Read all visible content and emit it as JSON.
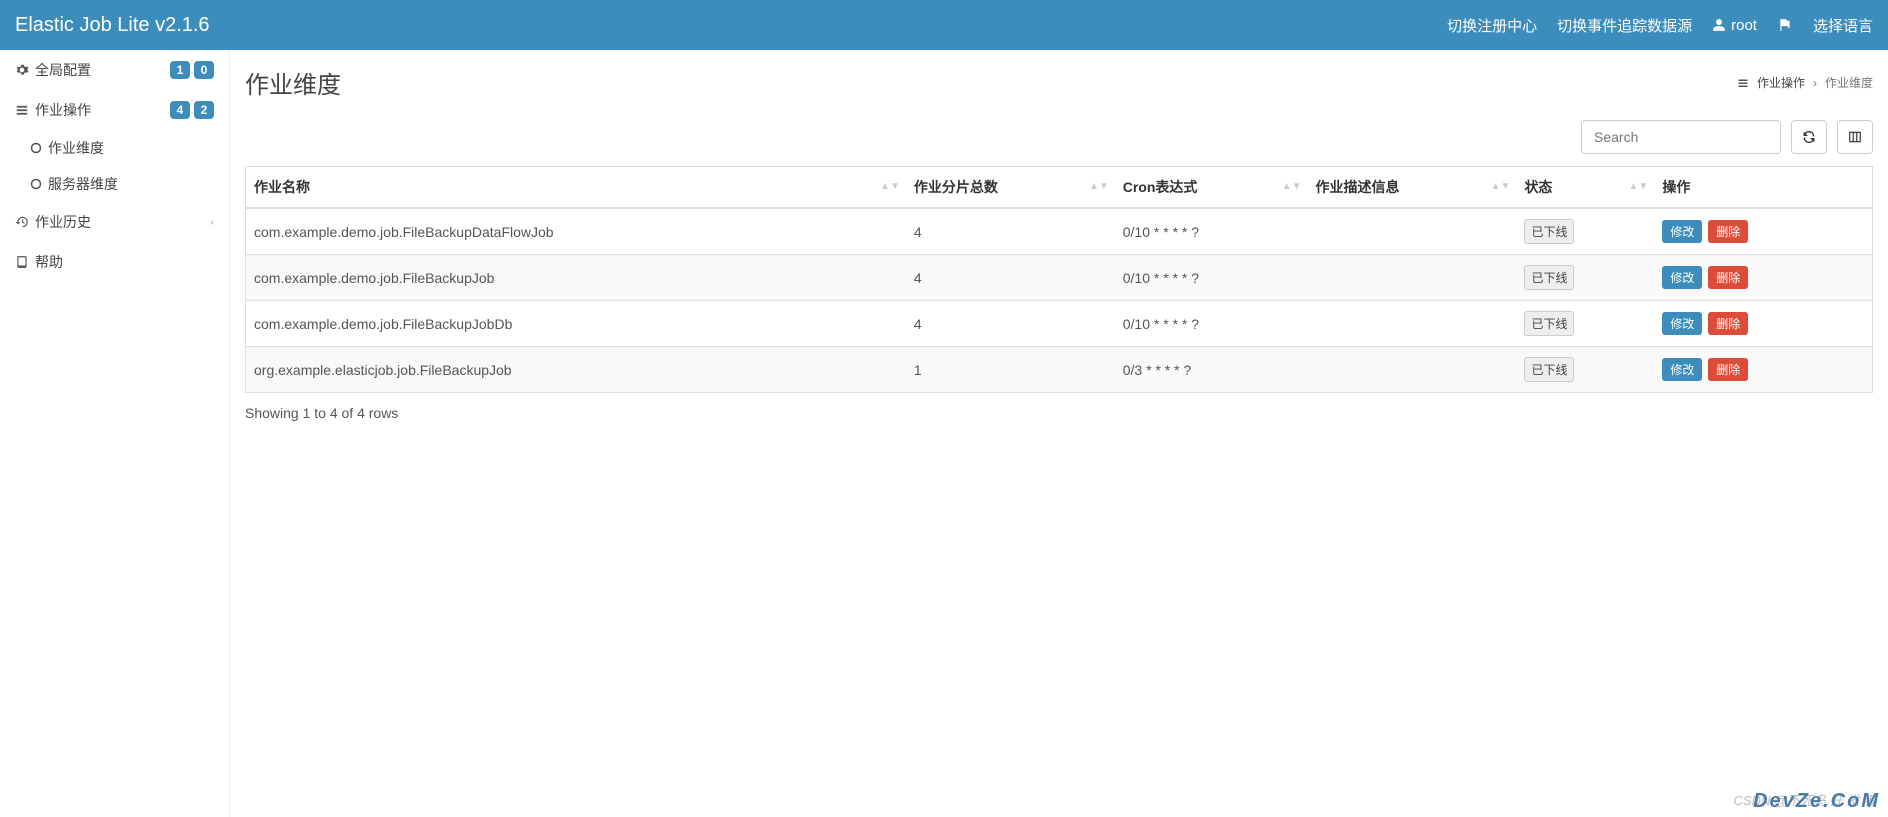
{
  "header": {
    "brand": "Elastic Job Lite v2.1.6",
    "nav": {
      "switchRegistry": "切换注册中心",
      "switchDataSource": "切换事件追踪数据源",
      "user": "root",
      "language": "选择语言"
    }
  },
  "sidebar": {
    "globalConfig": {
      "label": "全局配置",
      "badge1": "1",
      "badge2": "0"
    },
    "jobOps": {
      "label": "作业操作",
      "badge1": "4",
      "badge2": "2"
    },
    "jobDimension": {
      "label": "作业维度"
    },
    "serverDimension": {
      "label": "服务器维度"
    },
    "jobHistory": {
      "label": "作业历史"
    },
    "help": {
      "label": "帮助"
    }
  },
  "page": {
    "title": "作业维度",
    "breadcrumb": {
      "parent": "作业操作",
      "current": "作业维度"
    }
  },
  "toolbar": {
    "searchPlaceholder": "Search"
  },
  "table": {
    "headers": {
      "name": "作业名称",
      "shardCount": "作业分片总数",
      "cron": "Cron表达式",
      "desc": "作业描述信息",
      "status": "状态",
      "ops": "操作"
    },
    "rows": [
      {
        "name": "com.example.demo.job.FileBackupDataFlowJob",
        "shardCount": "4",
        "cron": "0/10 * * * * ?",
        "desc": "",
        "status": "已下线"
      },
      {
        "name": "com.example.demo.job.FileBackupJob",
        "shardCount": "4",
        "cron": "0/10 * * * * ?",
        "desc": "",
        "status": "已下线"
      },
      {
        "name": "com.example.demo.job.FileBackupJobDb",
        "shardCount": "4",
        "cron": "0/10 * * * * ?",
        "desc": "",
        "status": "已下线"
      },
      {
        "name": "org.example.elasticjob.job.FileBackupJob",
        "shardCount": "1",
        "cron": "0/3 * * * * ?",
        "desc": "",
        "status": "已下线"
      }
    ],
    "actions": {
      "edit": "修改",
      "delete": "删除"
    },
    "footer": "Showing 1 to 4 of 4 rows"
  },
  "watermark": {
    "line1": "CSDN @不死鸟.开 发 者",
    "line2": "DevZe.CoM"
  }
}
